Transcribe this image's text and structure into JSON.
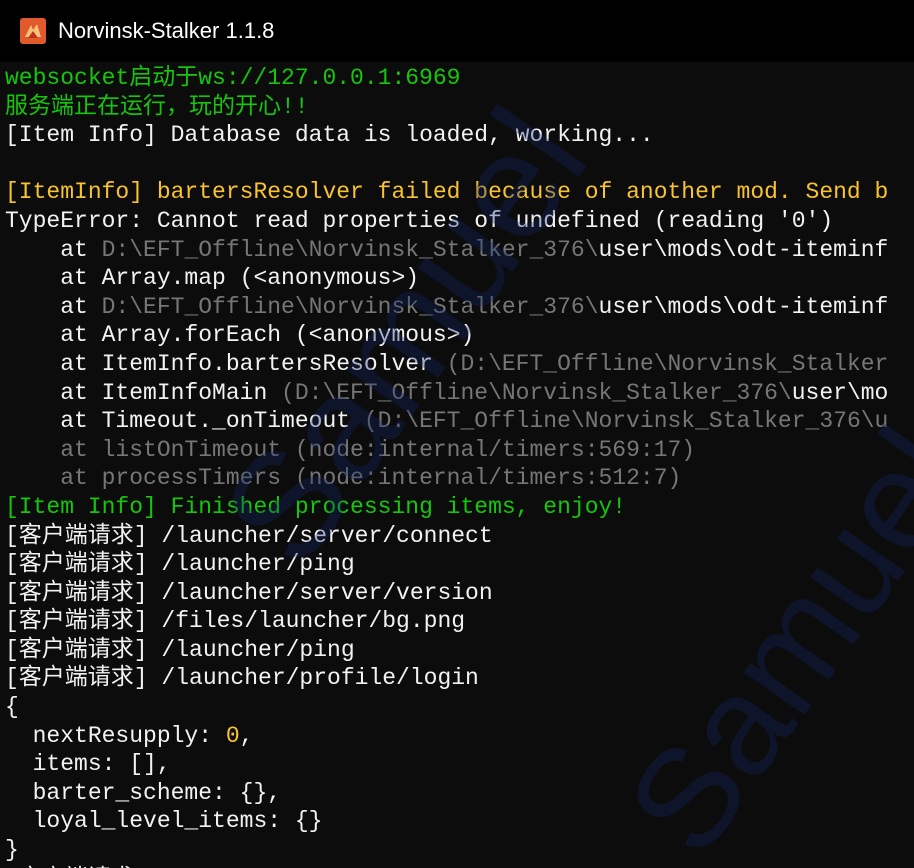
{
  "window": {
    "title": "Norvinsk-Stalker 1.1.8"
  },
  "colors": {
    "background": "#0c0c0c",
    "default_text": "#cccccc",
    "bright_white": "#f2f2f2",
    "green": "#16c60c",
    "yellow": "#f9c22f",
    "gray": "#767676",
    "titlebar": "#000000"
  },
  "console": {
    "lines": [
      {
        "segments": [
          {
            "text": "websocket启动于ws://127.0.0.1:6969",
            "color": "green"
          }
        ]
      },
      {
        "segments": [
          {
            "text": "服务端正在运行，玩的开心!!",
            "color": "green"
          }
        ]
      },
      {
        "segments": [
          {
            "text": "[Item Info] Database data is loaded, working...",
            "color": "bright_white"
          }
        ]
      },
      {
        "segments": [
          {
            "text": "",
            "color": "default_text"
          }
        ]
      },
      {
        "segments": [
          {
            "text": "[ItemInfo] bartersResolver failed because of another mod. Send b",
            "color": "yellow"
          }
        ]
      },
      {
        "segments": [
          {
            "text": "TypeError: Cannot read properties of undefined (reading '0')",
            "color": "bright_white"
          }
        ]
      },
      {
        "segments": [
          {
            "text": "    at ",
            "color": "bright_white"
          },
          {
            "text": "D:\\EFT_Offline\\Norvinsk_Stalker_376\\",
            "color": "gray"
          },
          {
            "text": "user\\mods\\odt-iteminf",
            "color": "bright_white"
          }
        ]
      },
      {
        "segments": [
          {
            "text": "    at Array.map (<anonymous>)",
            "color": "bright_white"
          }
        ]
      },
      {
        "segments": [
          {
            "text": "    at ",
            "color": "bright_white"
          },
          {
            "text": "D:\\EFT_Offline\\Norvinsk_Stalker_376\\",
            "color": "gray"
          },
          {
            "text": "user\\mods\\odt-iteminf",
            "color": "bright_white"
          }
        ]
      },
      {
        "segments": [
          {
            "text": "    at Array.forEach (<anonymous>)",
            "color": "bright_white"
          }
        ]
      },
      {
        "segments": [
          {
            "text": "    at ItemInfo.bartersResolver ",
            "color": "bright_white"
          },
          {
            "text": "(D:\\EFT_Offline\\Norvinsk_Stalker",
            "color": "gray"
          }
        ]
      },
      {
        "segments": [
          {
            "text": "    at ItemInfoMain ",
            "color": "bright_white"
          },
          {
            "text": "(D:\\EFT_Offline\\Norvinsk_Stalker_376\\",
            "color": "gray"
          },
          {
            "text": "user\\mo",
            "color": "bright_white"
          }
        ]
      },
      {
        "segments": [
          {
            "text": "    at Timeout._onTimeout ",
            "color": "bright_white"
          },
          {
            "text": "(D:\\EFT_Offline\\Norvinsk_Stalker_376\\u",
            "color": "gray"
          }
        ]
      },
      {
        "segments": [
          {
            "text": "    at listOnTimeout (node:internal/timers:569:17)",
            "color": "gray"
          }
        ]
      },
      {
        "segments": [
          {
            "text": "    at processTimers (node:internal/timers:512:7)",
            "color": "gray"
          }
        ]
      },
      {
        "segments": [
          {
            "text": "[Item Info] Finished processing items, enjoy!",
            "color": "green"
          }
        ]
      },
      {
        "segments": [
          {
            "text": "[客户端请求] /launcher/server/connect",
            "color": "bright_white"
          }
        ]
      },
      {
        "segments": [
          {
            "text": "[客户端请求] /launcher/ping",
            "color": "bright_white"
          }
        ]
      },
      {
        "segments": [
          {
            "text": "[客户端请求] /launcher/server/version",
            "color": "bright_white"
          }
        ]
      },
      {
        "segments": [
          {
            "text": "[客户端请求] /files/launcher/bg.png",
            "color": "bright_white"
          }
        ]
      },
      {
        "segments": [
          {
            "text": "[客户端请求] /launcher/ping",
            "color": "bright_white"
          }
        ]
      },
      {
        "segments": [
          {
            "text": "[客户端请求] /launcher/profile/login",
            "color": "bright_white"
          }
        ]
      },
      {
        "segments": [
          {
            "text": "{",
            "color": "bright_white"
          }
        ]
      },
      {
        "segments": [
          {
            "text": "  nextResupply: ",
            "color": "bright_white"
          },
          {
            "text": "0",
            "color": "yellow"
          },
          {
            "text": ",",
            "color": "bright_white"
          }
        ]
      },
      {
        "segments": [
          {
            "text": "  items: [],",
            "color": "bright_white"
          }
        ]
      },
      {
        "segments": [
          {
            "text": "  barter_scheme: {},",
            "color": "bright_white"
          }
        ]
      },
      {
        "segments": [
          {
            "text": "  loyal_level_items: {}",
            "color": "bright_white"
          }
        ]
      },
      {
        "segments": [
          {
            "text": "}",
            "color": "bright_white"
          }
        ]
      },
      {
        "segments": [
          {
            "text": "[客户端请求] /launcher/profile",
            "color": "bright_white"
          }
        ]
      }
    ]
  },
  "watermark": {
    "text": "Samuel"
  }
}
